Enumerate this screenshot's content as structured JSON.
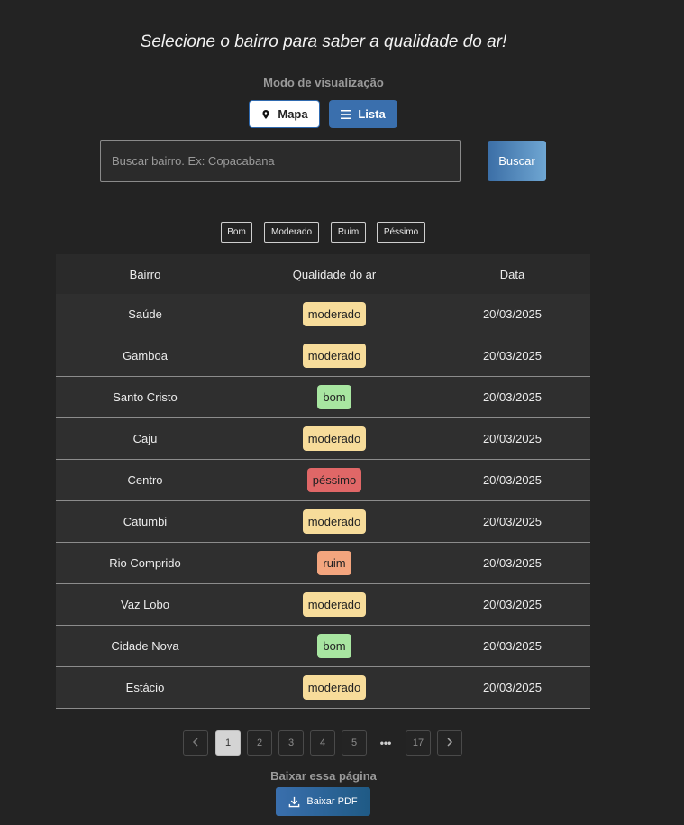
{
  "header": {
    "title": "Selecione o bairro para saber a qualidade do ar!",
    "mode_label": "Modo de visualização",
    "mode_map": "Mapa",
    "mode_list": "Lista"
  },
  "search": {
    "placeholder": "Buscar bairro. Ex: Copacabana",
    "value": "",
    "button": "Buscar"
  },
  "legend": [
    "Bom",
    "Moderado",
    "Ruim",
    "Péssimo"
  ],
  "status_colors": {
    "bom": "#a8e6a1",
    "moderado": "#f7dc9a",
    "ruim": "#f3a57e",
    "péssimo": "#e06767"
  },
  "table": {
    "headers": [
      "Bairro",
      "Qualidade do ar",
      "Data"
    ],
    "rows": [
      {
        "bairro": "Saúde",
        "qualidade": "moderado",
        "data": "20/03/2025"
      },
      {
        "bairro": "Gamboa",
        "qualidade": "moderado",
        "data": "20/03/2025"
      },
      {
        "bairro": "Santo Cristo",
        "qualidade": "bom",
        "data": "20/03/2025"
      },
      {
        "bairro": "Caju",
        "qualidade": "moderado",
        "data": "20/03/2025"
      },
      {
        "bairro": "Centro",
        "qualidade": "péssimo",
        "data": "20/03/2025"
      },
      {
        "bairro": "Catumbi",
        "qualidade": "moderado",
        "data": "20/03/2025"
      },
      {
        "bairro": "Rio Comprido",
        "qualidade": "ruim",
        "data": "20/03/2025"
      },
      {
        "bairro": "Vaz Lobo",
        "qualidade": "moderado",
        "data": "20/03/2025"
      },
      {
        "bairro": "Cidade Nova",
        "qualidade": "bom",
        "data": "20/03/2025"
      },
      {
        "bairro": "Estácio",
        "qualidade": "moderado",
        "data": "20/03/2025"
      }
    ]
  },
  "pagination": {
    "pages": [
      "1",
      "2",
      "3",
      "4",
      "5"
    ],
    "ellipsis": "•••",
    "last": "17",
    "current": "1",
    "prev_icon": "chevron-left-icon",
    "next_icon": "chevron-right-icon"
  },
  "download": {
    "label": "Baixar essa página",
    "button": "Baixar PDF",
    "icon": "download-icon"
  }
}
